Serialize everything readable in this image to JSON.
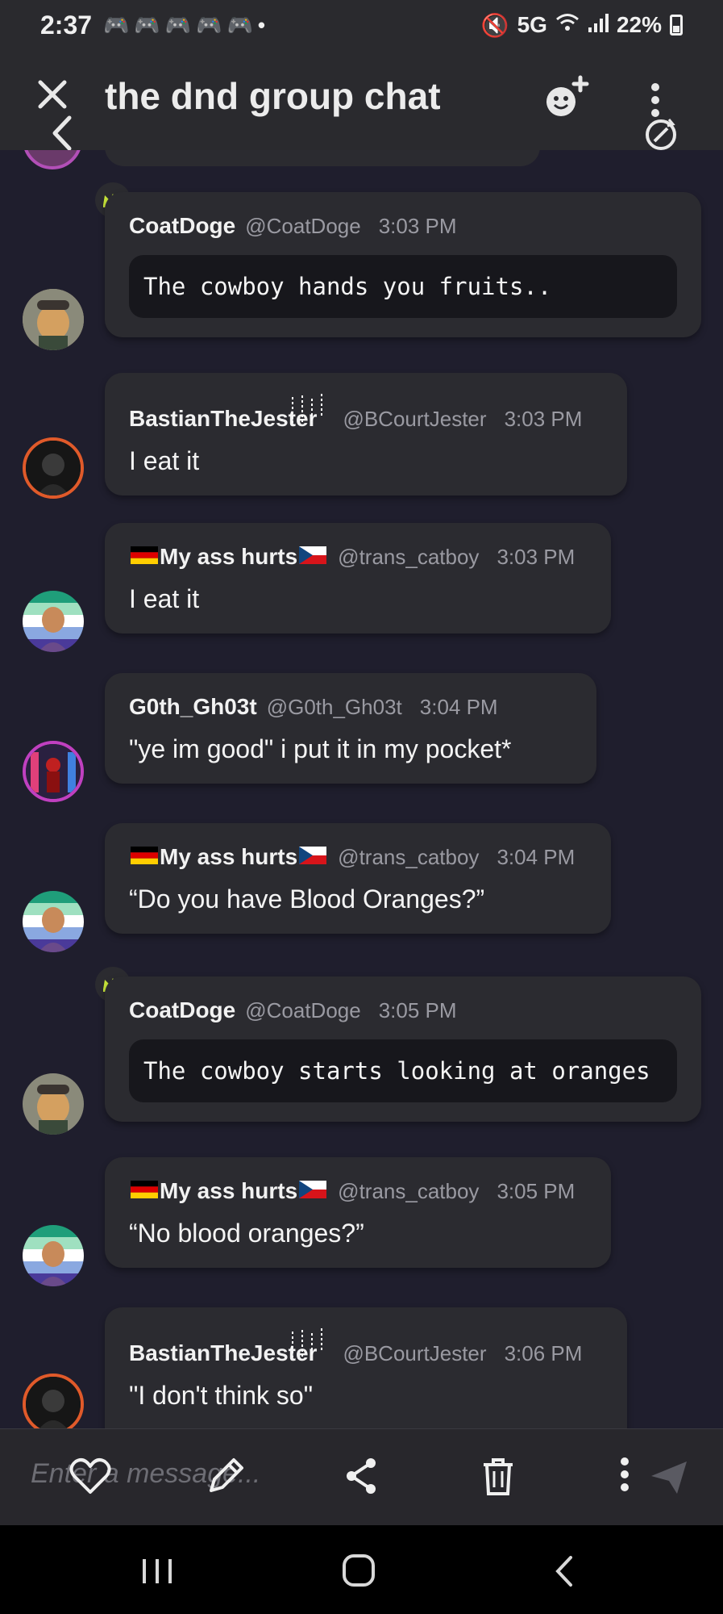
{
  "status_bar": {
    "time": "2:37",
    "notification_icons": [
      "game-controller-icon",
      "game-controller-icon",
      "game-controller-icon",
      "game-controller-icon",
      "game-controller-icon",
      "dot-icon"
    ],
    "network": "5G",
    "battery": "22%"
  },
  "header": {
    "title": "the dnd group chat",
    "icons": [
      "close-icon",
      "back-icon",
      "add-emoji-icon",
      "more-vertical-icon",
      "sync-icon"
    ]
  },
  "messages": [
    {
      "name": "CoatDoge",
      "handle": "@CoatDoge",
      "time": "3:03 PM",
      "text": "The cowboy hands you fruits..",
      "code": true,
      "crown": true,
      "avatar": "dog"
    },
    {
      "name": "BastianTheJester",
      "handle": "@BCourtJester",
      "time": "3:03 PM",
      "text": "I eat it",
      "code": false,
      "crown": false,
      "avatar": "jester"
    },
    {
      "name_prefix_flag": "germany",
      "name": "My ass hurts",
      "name_suffix_flag": "czech",
      "handle": "@trans_catboy",
      "time": "3:03 PM",
      "text": "I eat it",
      "code": false,
      "crown": false,
      "avatar": "catboy"
    },
    {
      "name": "G0th_Gh03t",
      "handle": "@G0th_Gh03t",
      "time": "3:04 PM",
      "text": "\"ye im good\" i put it in my pocket*",
      "code": false,
      "crown": false,
      "avatar": "ghost"
    },
    {
      "name_prefix_flag": "germany",
      "name": "My ass hurts",
      "name_suffix_flag": "czech",
      "handle": "@trans_catboy",
      "time": "3:04 PM",
      "text": "“Do you have Blood Oranges?”",
      "code": false,
      "crown": false,
      "avatar": "catboy"
    },
    {
      "name": "CoatDoge",
      "handle": "@CoatDoge",
      "time": "3:05 PM",
      "text": "The cowboy starts looking at oranges",
      "code": true,
      "crown": true,
      "avatar": "dog"
    },
    {
      "name_prefix_flag": "germany",
      "name": "My ass hurts",
      "name_suffix_flag": "czech",
      "handle": "@trans_catboy",
      "time": "3:05 PM",
      "text": "“No blood oranges?”",
      "code": false,
      "crown": false,
      "avatar": "catboy"
    },
    {
      "name": "BastianTheJester",
      "handle": "@BCourtJester",
      "time": "3:06 PM",
      "text": "\"I don't think so\"",
      "code": false,
      "crown": false,
      "avatar": "jester"
    }
  ],
  "composer": {
    "placeholder": "Enter a message...",
    "icons": [
      "heart-icon",
      "edit-icon",
      "share-icon",
      "trash-icon",
      "more-vertical-icon",
      "send-icon"
    ]
  },
  "nav_bar": {
    "icons": [
      "recents-icon",
      "home-icon",
      "back-icon"
    ]
  },
  "colors": {
    "background": "#1f1e2d",
    "bubble": "#2b2b30",
    "code_block": "#17171c",
    "header": "#2a2a2e",
    "crown": "#c8e63a"
  }
}
